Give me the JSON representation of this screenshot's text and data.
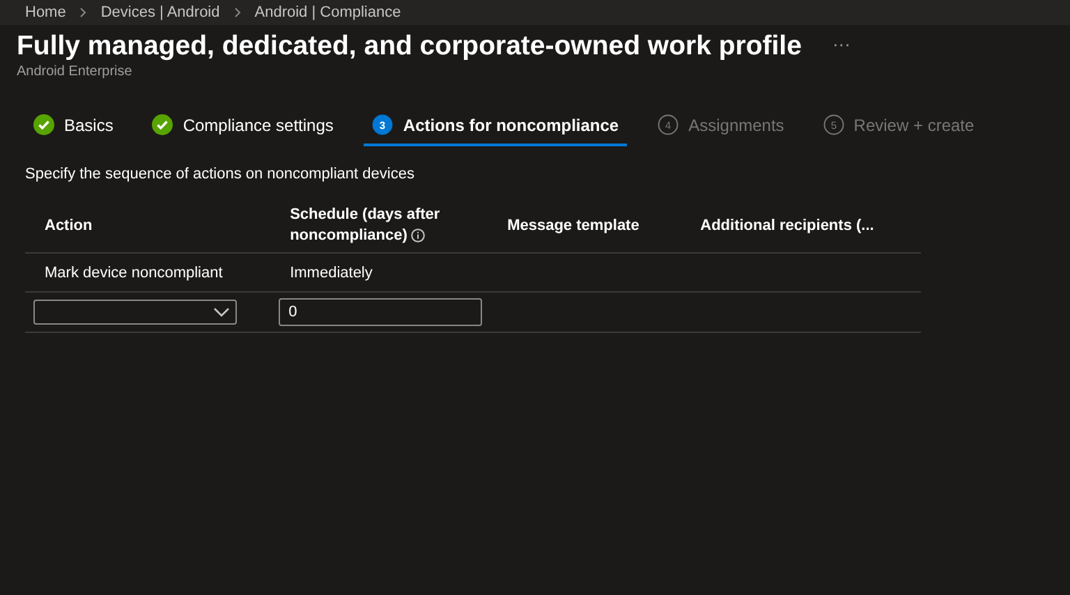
{
  "breadcrumb": [
    "Home",
    "Devices | Android",
    "Android | Compliance"
  ],
  "header": {
    "title": "Fully managed, dedicated, and corporate-owned work profile",
    "subtitle": "Android Enterprise",
    "more": "···"
  },
  "steps": [
    {
      "label": "Basics",
      "completed": true,
      "selected": false
    },
    {
      "label": "Compliance settings",
      "completed": true,
      "selected": false
    },
    {
      "label": "Actions for noncompliance",
      "number": "3",
      "completed": false,
      "selected": true
    },
    {
      "label": "Assignments",
      "number": "4",
      "completed": false,
      "selected": false
    },
    {
      "label": "Review + create",
      "number": "5",
      "completed": false,
      "selected": false
    }
  ],
  "description": "Specify the sequence of actions on noncompliant devices",
  "table": {
    "columns": [
      {
        "label": "Action",
        "info": false
      },
      {
        "label": "Schedule (days after noncompliance)",
        "info": true
      },
      {
        "label": "Message template",
        "info": false
      },
      {
        "label": "Additional recipients (...",
        "info": false
      }
    ],
    "rows": [
      {
        "kind": "text",
        "cells": [
          "Mark device noncompliant",
          "Immediately"
        ]
      },
      {
        "kind": "input",
        "action_value": "",
        "schedule_value": "0"
      }
    ]
  }
}
